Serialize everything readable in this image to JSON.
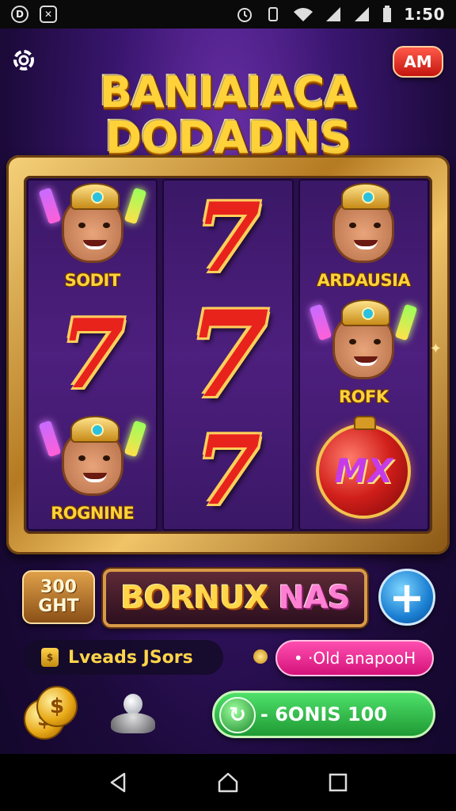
{
  "status_bar": {
    "time": "1:50",
    "left_icons": [
      "d-icon",
      "image-icon"
    ],
    "right_icons": [
      "alarm-icon",
      "vibrate-icon",
      "wifi-icon",
      "signal-icon",
      "signal-icon-2",
      "battery-icon"
    ]
  },
  "header": {
    "title_line1": "BANIAIACA",
    "title_line2": "DODADNS",
    "am_button": "AM"
  },
  "reels": [
    [
      {
        "type": "character",
        "label": "SODIT"
      },
      {
        "type": "seven",
        "label": "7"
      },
      {
        "type": "character",
        "label": "ROGNINE"
      }
    ],
    [
      {
        "type": "seven",
        "label": "7"
      },
      {
        "type": "seven",
        "label": "7"
      },
      {
        "type": "seven",
        "label": "7"
      }
    ],
    [
      {
        "type": "character",
        "label": "ARDAUSIA"
      },
      {
        "type": "character",
        "label": "ROFK"
      },
      {
        "type": "bomb",
        "label": "MX"
      }
    ]
  ],
  "controls": {
    "bet_value": "300",
    "bet_label": "GHT",
    "bonus_text_gold": "BORNUX",
    "bonus_text_pink": "NAS",
    "plus_label": "+",
    "levels_text": "Lveads JSors",
    "pink_pill_text": "• ·Old anapooH",
    "green_button_text": "- 6ONIS 100"
  },
  "colors": {
    "background": "#3a1670",
    "gold": "#ffd23a",
    "seven_red": "#e8231b",
    "frame_gold": "#d8a040",
    "green_button": "#2fbf4a",
    "pink_pill": "#ff3fa4",
    "plus_blue": "#1b7fd2"
  }
}
